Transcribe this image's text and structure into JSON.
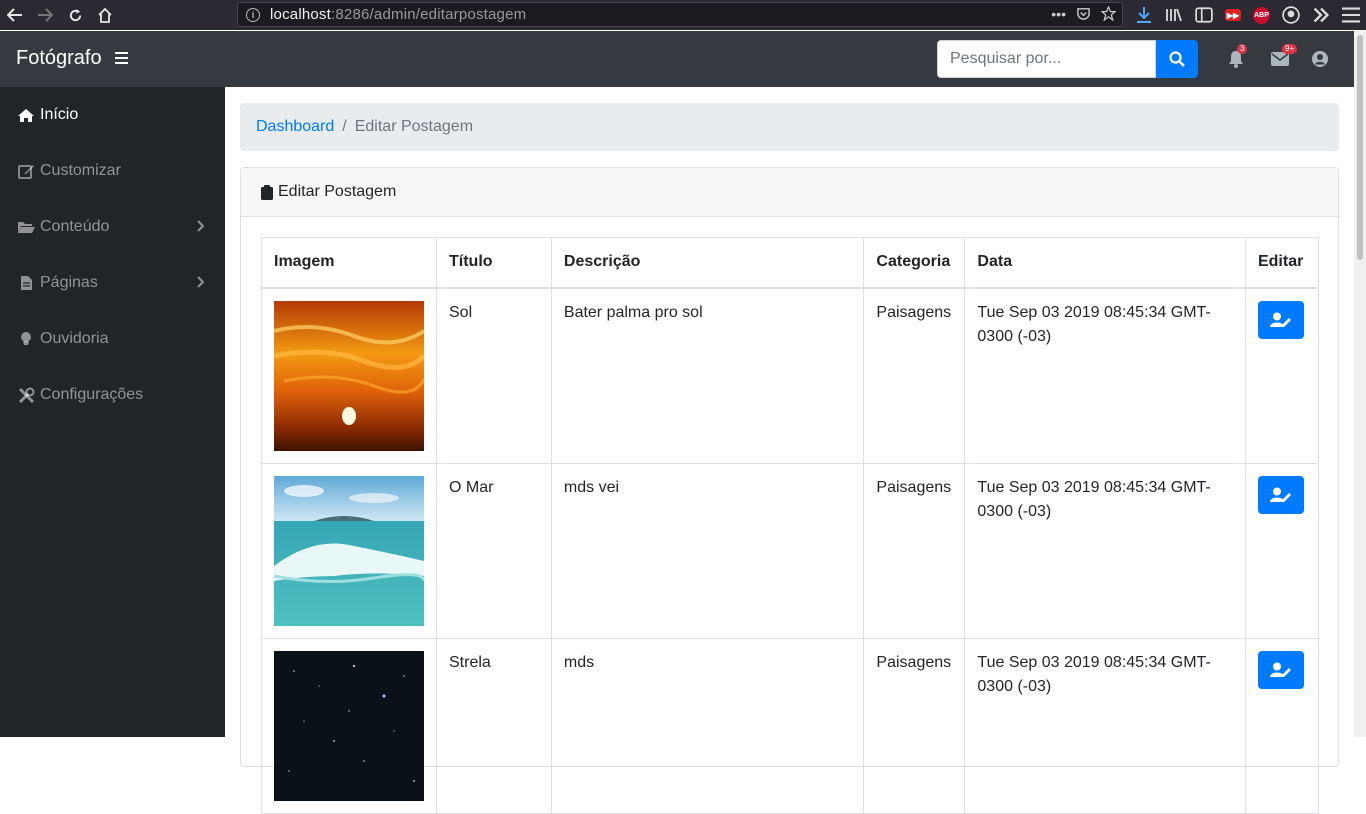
{
  "browser": {
    "url_host": "localhost",
    "url_path": ":8286/admin/editarpostagem",
    "badge_count": "9+",
    "abp_label": "ABP"
  },
  "header": {
    "brand": "Fotógrafo",
    "search_placeholder": "Pesquisar por...",
    "notifications_badge": "3",
    "messages_badge": "9+"
  },
  "sidebar": {
    "items": [
      {
        "label": "Início",
        "icon": "home-icon"
      },
      {
        "label": "Customizar",
        "icon": "edit-icon"
      },
      {
        "label": "Conteúdo",
        "icon": "folder-open-icon"
      },
      {
        "label": "Páginas",
        "icon": "file-icon"
      },
      {
        "label": "Ouvidoria",
        "icon": "lightbulb-icon"
      },
      {
        "label": "Configurações",
        "icon": "tools-icon"
      }
    ]
  },
  "breadcrumb": {
    "link": "Dashboard",
    "separator": "/",
    "current": "Editar Postagem"
  },
  "card": {
    "title": "Editar Postagem"
  },
  "table": {
    "headers": [
      "Imagem",
      "Título",
      "Descrição",
      "Categoria",
      "Data",
      "Editar"
    ],
    "rows": [
      {
        "image": "sunset",
        "title": "Sol",
        "description": "Bater palma pro sol",
        "category": "Paisagens",
        "date": "Tue Sep 03 2019 08:45:34 GMT-0300 (-03)"
      },
      {
        "image": "ocean-wave",
        "title": "O Mar",
        "description": "mds vei",
        "category": "Paisagens",
        "date": "Tue Sep 03 2019 08:45:34 GMT-0300 (-03)"
      },
      {
        "image": "starry-sky",
        "title": "Strela",
        "description": "mds",
        "category": "Paisagens",
        "date": "Tue Sep 03 2019 08:45:34 GMT-0300 (-03)"
      }
    ]
  },
  "colors": {
    "primary": "#007bff",
    "header_bg": "#343a40",
    "sidebar_bg": "#212529",
    "badge": "#dc3545"
  }
}
